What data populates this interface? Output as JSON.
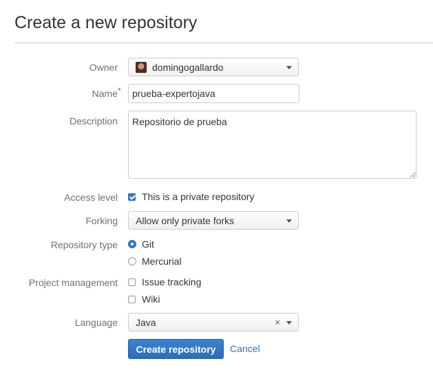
{
  "page": {
    "title": "Create a new repository"
  },
  "form": {
    "owner": {
      "label": "Owner",
      "value": "domingogallardo"
    },
    "name": {
      "label": "Name",
      "required_mark": "*",
      "value": "prueba-expertojava"
    },
    "description": {
      "label": "Description",
      "value": "Repositorio de prueba"
    },
    "access": {
      "label": "Access level",
      "checkbox_label": "This is a private repository",
      "checked": true
    },
    "forking": {
      "label": "Forking",
      "value": "Allow only private forks"
    },
    "repo_type": {
      "label": "Repository type",
      "options": [
        {
          "label": "Git",
          "selected": true
        },
        {
          "label": "Mercurial",
          "selected": false
        }
      ]
    },
    "project_management": {
      "label": "Project management",
      "options": [
        {
          "label": "Issue tracking",
          "checked": false
        },
        {
          "label": "Wiki",
          "checked": false
        }
      ]
    },
    "language": {
      "label": "Language",
      "value": "Java",
      "clear_glyph": "×"
    }
  },
  "actions": {
    "create_label": "Create repository",
    "cancel_label": "Cancel"
  },
  "colors": {
    "primary": "#2f79d3",
    "link": "#3572b0",
    "required": "#d04437"
  }
}
